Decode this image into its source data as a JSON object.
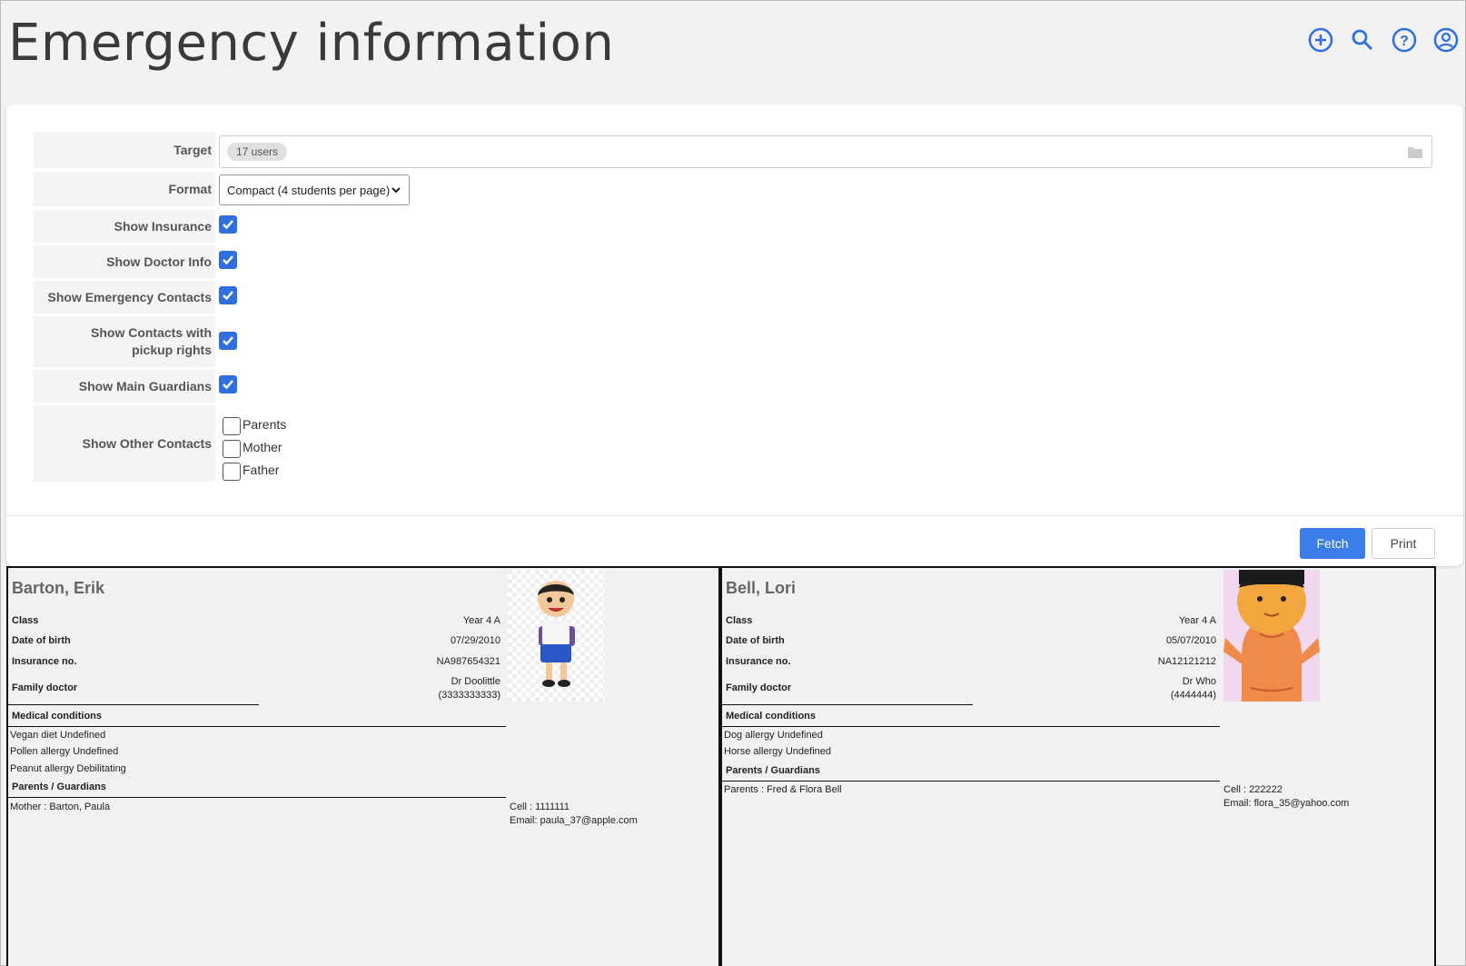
{
  "page": {
    "title": "Emergency information"
  },
  "toolbar": {
    "icons": [
      "add-circle-icon",
      "search-icon",
      "help-icon",
      "account-icon"
    ],
    "accent": "#2f6fdf"
  },
  "form": {
    "target_label": "Target",
    "target_chip": "17 users",
    "format_label": "Format",
    "format_value": "Compact (4 students per page)",
    "show_insurance": "Show Insurance",
    "show_doctor": "Show Doctor Info",
    "show_emergency": "Show Emergency Contacts",
    "show_pickup": "Show Contacts with pickup rights",
    "show_guardians": "Show Main Guardians",
    "show_other": "Show Other Contacts",
    "other_options": [
      "Parents",
      "Mother",
      "Father"
    ]
  },
  "buttons": {
    "fetch": "Fetch",
    "print": "Print"
  },
  "students": [
    {
      "name": "Barton, Erik",
      "class_label": "Class",
      "class": "Year 4 A",
      "dob_label": "Date of birth",
      "dob": "07/29/2010",
      "ins_label": "Insurance no.",
      "ins": "NA987654321",
      "doc_label": "Family doctor",
      "doc_name": "Dr Doolittle",
      "doc_phone": "(3333333333)",
      "med_header": "Medical conditions",
      "conditions": [
        "Vegan diet Undefined",
        "Pollen allergy Undefined",
        "Peanut allergy Debilitating"
      ],
      "guard_header": "Parents / Guardians",
      "guardian": "Mother : Barton, Paula",
      "cell": "Cell : 1111111",
      "email": "Email: paula_37@apple.com"
    },
    {
      "name": "Bell, Lori",
      "class_label": "Class",
      "class": "Year 4 A",
      "dob_label": "Date of birth",
      "dob": "05/07/2010",
      "ins_label": "Insurance no.",
      "ins": "NA12121212",
      "doc_label": "Family doctor",
      "doc_name": "Dr Who",
      "doc_phone": "(4444444)",
      "med_header": "Medical conditions",
      "conditions": [
        "Dog allergy Undefined",
        "Horse allergy Undefined"
      ],
      "guard_header": "Parents / Guardians",
      "guardian": "Parents : Fred & Flora Bell",
      "cell": "Cell : 222222",
      "email": "Email: flora_35@yahoo.com"
    }
  ]
}
